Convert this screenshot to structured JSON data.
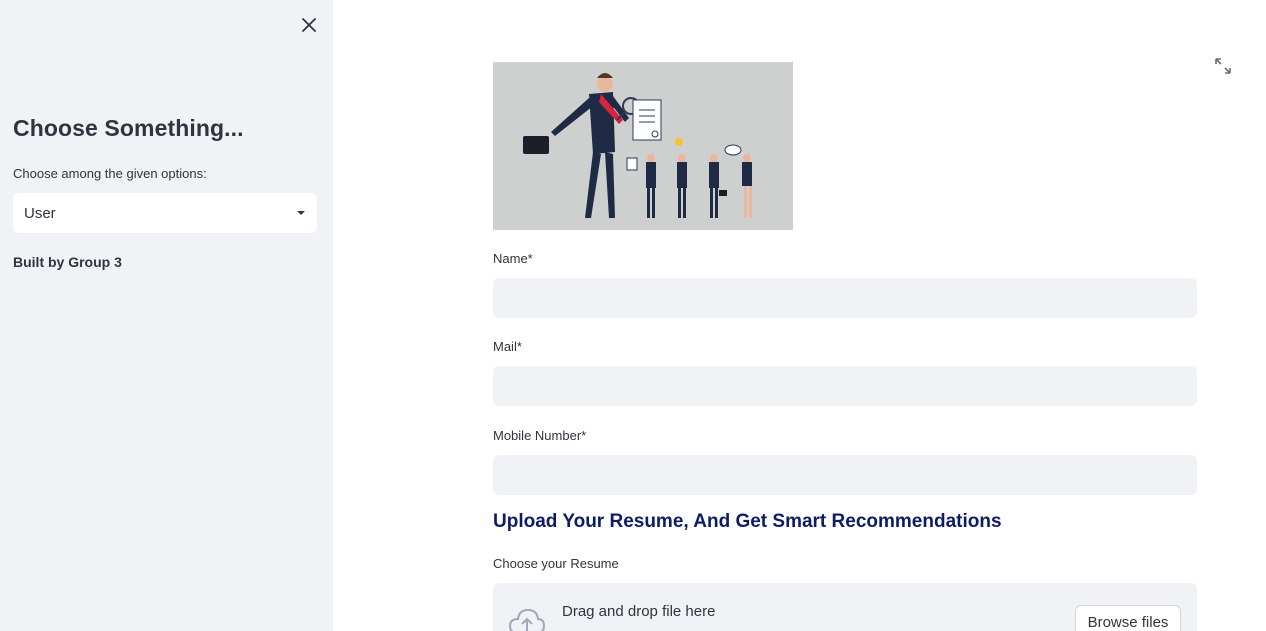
{
  "sidebar": {
    "title": "Choose Something...",
    "select_label": "Choose among the given options:",
    "select_value": "User",
    "credit": "Built by Group 3"
  },
  "form": {
    "name_label": "Name*",
    "mail_label": "Mail*",
    "mobile_label": "Mobile Number*",
    "section_heading": "Upload Your Resume, And Get Smart Recommendations",
    "resume_label": "Choose your Resume",
    "drop_text": "Drag and drop file here",
    "browse_label": "Browse files"
  },
  "colors": {
    "sidebar_bg": "#f0f2f6",
    "input_bg": "#f0f2f6",
    "heading_color": "#0e1c64",
    "text_color": "#31333f"
  },
  "icons": {
    "close": "close-icon",
    "fullscreen": "expand-icon",
    "select_caret": "caret-down-icon",
    "upload": "cloud-upload-icon"
  }
}
